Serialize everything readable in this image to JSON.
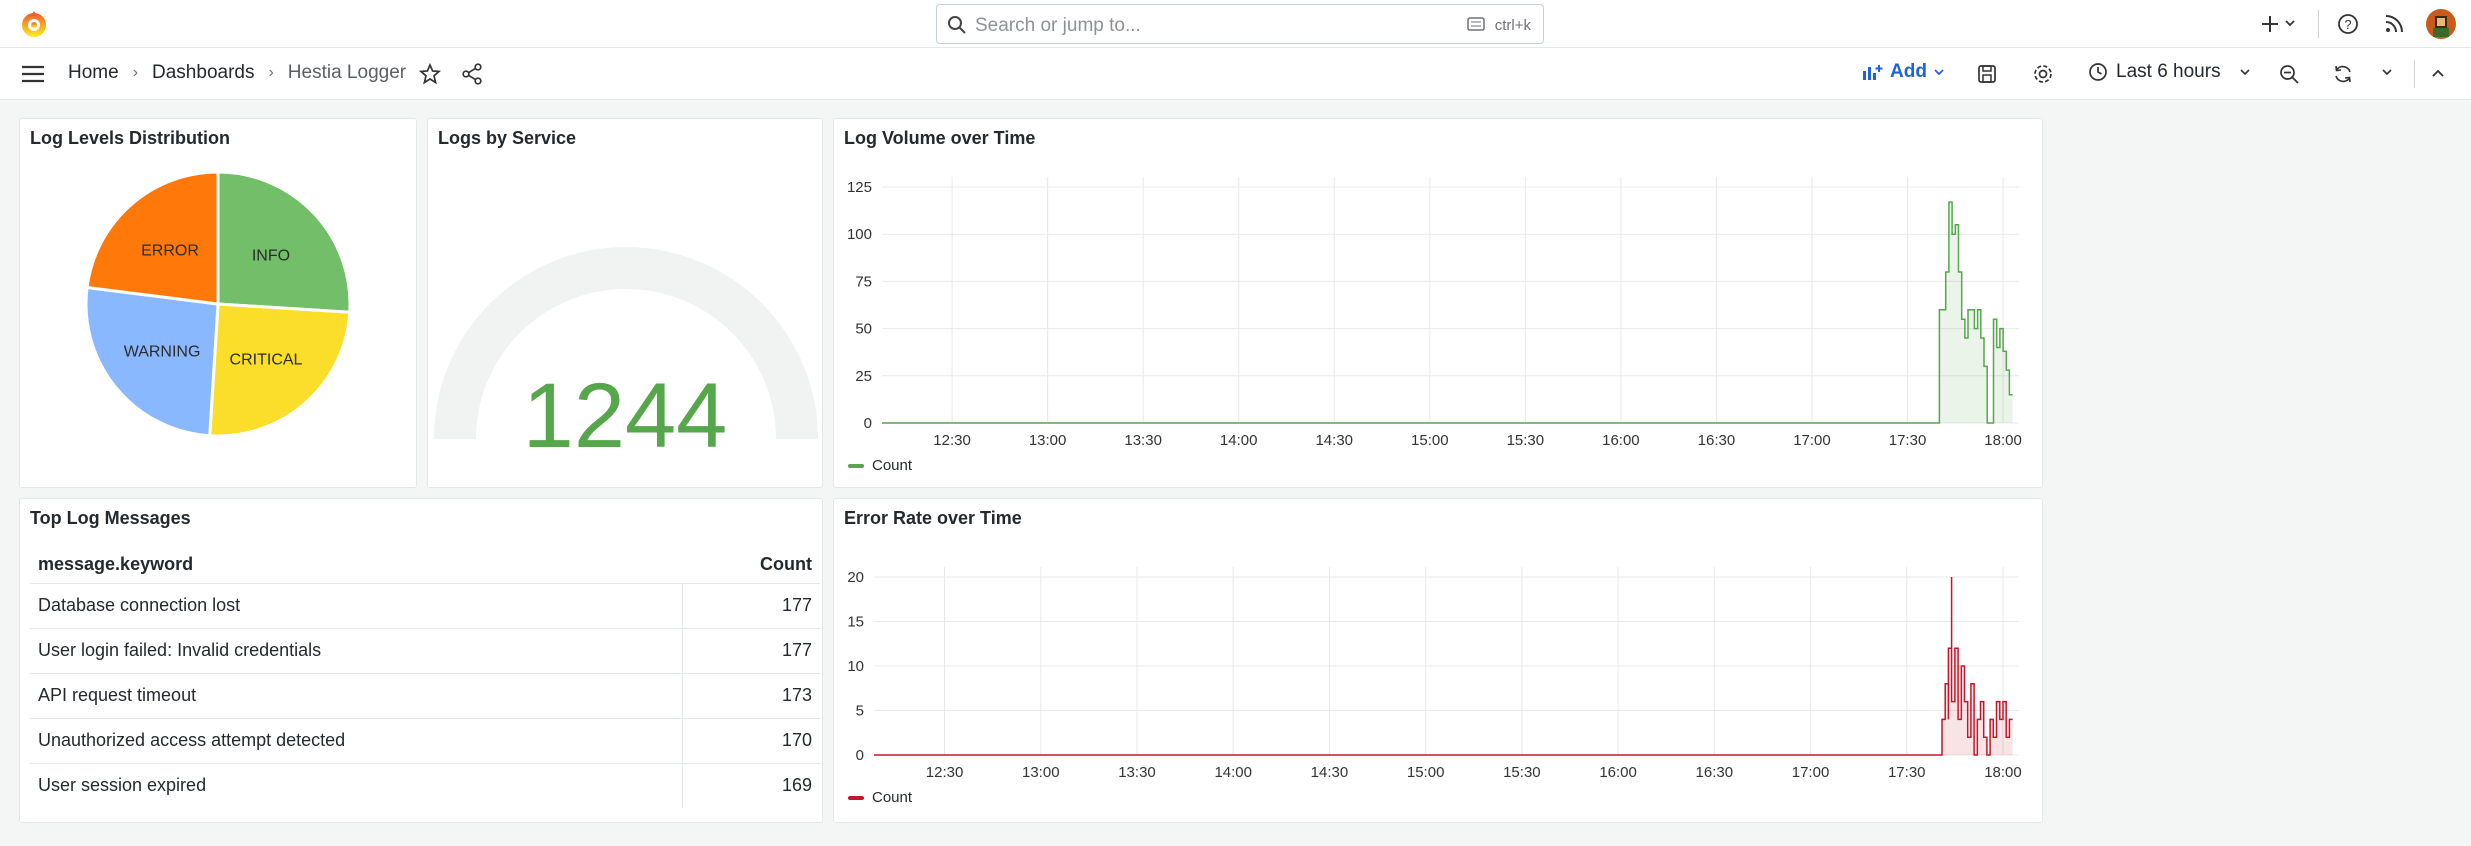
{
  "topbar": {
    "search_placeholder": "Search or jump to...",
    "search_shortcut": "ctrl+k",
    "icons": [
      "grafana-logo-icon",
      "search-icon",
      "keyboard-icon",
      "plus-icon",
      "help-icon",
      "rss-icon",
      "user-avatar"
    ]
  },
  "nav": {
    "breadcrumbs": [
      "Home",
      "Dashboards",
      "Hestia Logger"
    ],
    "add_label": "Add",
    "time_range": "Last 6 hours"
  },
  "panels": {
    "pie": {
      "title": "Log Levels Distribution"
    },
    "gauge": {
      "title": "Logs by Service",
      "value": "1244",
      "color": "#56a64b"
    },
    "volume": {
      "title": "Log Volume over Time",
      "legend": "Count",
      "color": "#56a64b"
    },
    "table": {
      "title": "Top Log Messages"
    },
    "errors": {
      "title": "Error Rate over Time",
      "legend": "Count",
      "color": "#c4162a"
    }
  },
  "table_data": {
    "columns": [
      "message.keyword",
      "Count"
    ],
    "rows": [
      [
        "Database connection lost",
        "177"
      ],
      [
        "User login failed: Invalid credentials",
        "177"
      ],
      [
        "API request timeout",
        "173"
      ],
      [
        "Unauthorized access attempt detected",
        "170"
      ],
      [
        "User session expired",
        "169"
      ]
    ]
  },
  "chart_data": [
    {
      "type": "pie",
      "title": "Log Levels Distribution",
      "categories": [
        "INFO",
        "CRITICAL",
        "WARNING",
        "ERROR"
      ],
      "values": [
        26,
        25,
        26,
        23
      ],
      "colors": [
        "#73bf69",
        "#fade2a",
        "#8ab8ff",
        "#ff780a"
      ]
    },
    {
      "type": "area",
      "title": "Log Volume over Time",
      "x_ticks": [
        "12:30",
        "13:00",
        "13:30",
        "14:00",
        "14:30",
        "15:00",
        "15:30",
        "16:00",
        "16:30",
        "17:00",
        "17:30",
        "18:00"
      ],
      "y_ticks": [
        0,
        25,
        50,
        75,
        100,
        125
      ],
      "ylim": [
        0,
        125
      ],
      "series": [
        {
          "name": "Count",
          "points": [
            [
              "12:08",
              0
            ],
            [
              "17:40",
              0
            ],
            [
              "17:40",
              60
            ],
            [
              "17:42",
              60
            ],
            [
              "17:42",
              80
            ],
            [
              "17:43",
              80
            ],
            [
              "17:43",
              117
            ],
            [
              "17:44",
              117
            ],
            [
              "17:44",
              100
            ],
            [
              "17:45",
              100
            ],
            [
              "17:45",
              105
            ],
            [
              "17:46",
              105
            ],
            [
              "17:46",
              80
            ],
            [
              "17:47",
              80
            ],
            [
              "17:47",
              55
            ],
            [
              "17:48",
              55
            ],
            [
              "17:48",
              45
            ],
            [
              "17:49",
              45
            ],
            [
              "17:49",
              60
            ],
            [
              "17:51",
              60
            ],
            [
              "17:51",
              50
            ],
            [
              "17:52",
              50
            ],
            [
              "17:52",
              60
            ],
            [
              "17:53",
              60
            ],
            [
              "17:53",
              45
            ],
            [
              "17:54",
              45
            ],
            [
              "17:54",
              30
            ],
            [
              "17:55",
              30
            ],
            [
              "17:55",
              0
            ],
            [
              "17:57",
              0
            ],
            [
              "17:57",
              55
            ],
            [
              "17:58",
              55
            ],
            [
              "17:58",
              40
            ],
            [
              "17:59",
              40
            ],
            [
              "17:59",
              50
            ],
            [
              "18:00",
              50
            ],
            [
              "18:00",
              38
            ],
            [
              "18:01",
              38
            ],
            [
              "18:01",
              28
            ],
            [
              "18:02",
              28
            ],
            [
              "18:02",
              15
            ],
            [
              "18:03",
              15
            ]
          ]
        }
      ]
    },
    {
      "type": "area",
      "title": "Error Rate over Time",
      "x_ticks": [
        "12:30",
        "13:00",
        "13:30",
        "14:00",
        "14:30",
        "15:00",
        "15:30",
        "16:00",
        "16:30",
        "17:00",
        "17:30",
        "18:00"
      ],
      "y_ticks": [
        0,
        5,
        10,
        15,
        20
      ],
      "ylim": [
        0,
        20
      ],
      "series": [
        {
          "name": "Count",
          "points": [
            [
              "12:08",
              0
            ],
            [
              "17:41",
              0
            ],
            [
              "17:41",
              4
            ],
            [
              "17:42",
              4
            ],
            [
              "17:42",
              8
            ],
            [
              "17:43",
              8
            ],
            [
              "17:43",
              4
            ],
            [
              "17:43",
              12
            ],
            [
              "17:44",
              12
            ],
            [
              "17:44",
              20
            ],
            [
              "17:44",
              6
            ],
            [
              "17:45",
              6
            ],
            [
              "17:45",
              12
            ],
            [
              "17:46",
              12
            ],
            [
              "17:46",
              4
            ],
            [
              "17:47",
              4
            ],
            [
              "17:47",
              10
            ],
            [
              "17:48",
              10
            ],
            [
              "17:48",
              6
            ],
            [
              "17:49",
              6
            ],
            [
              "17:49",
              2
            ],
            [
              "17:50",
              2
            ],
            [
              "17:50",
              8
            ],
            [
              "17:51",
              8
            ],
            [
              "17:51",
              0
            ],
            [
              "17:52",
              0
            ],
            [
              "17:52",
              4
            ],
            [
              "17:53",
              4
            ],
            [
              "17:53",
              6
            ],
            [
              "17:54",
              6
            ],
            [
              "17:54",
              2
            ],
            [
              "17:55",
              2
            ],
            [
              "17:55",
              0
            ],
            [
              "17:56",
              0
            ],
            [
              "17:56",
              4
            ],
            [
              "17:57",
              4
            ],
            [
              "17:57",
              2
            ],
            [
              "17:58",
              2
            ],
            [
              "17:58",
              6
            ],
            [
              "17:59",
              6
            ],
            [
              "17:59",
              4
            ],
            [
              "18:00",
              4
            ],
            [
              "18:00",
              6
            ],
            [
              "18:01",
              6
            ],
            [
              "18:01",
              2
            ],
            [
              "18:02",
              2
            ],
            [
              "18:02",
              4
            ],
            [
              "18:03",
              4
            ]
          ]
        }
      ]
    }
  ]
}
